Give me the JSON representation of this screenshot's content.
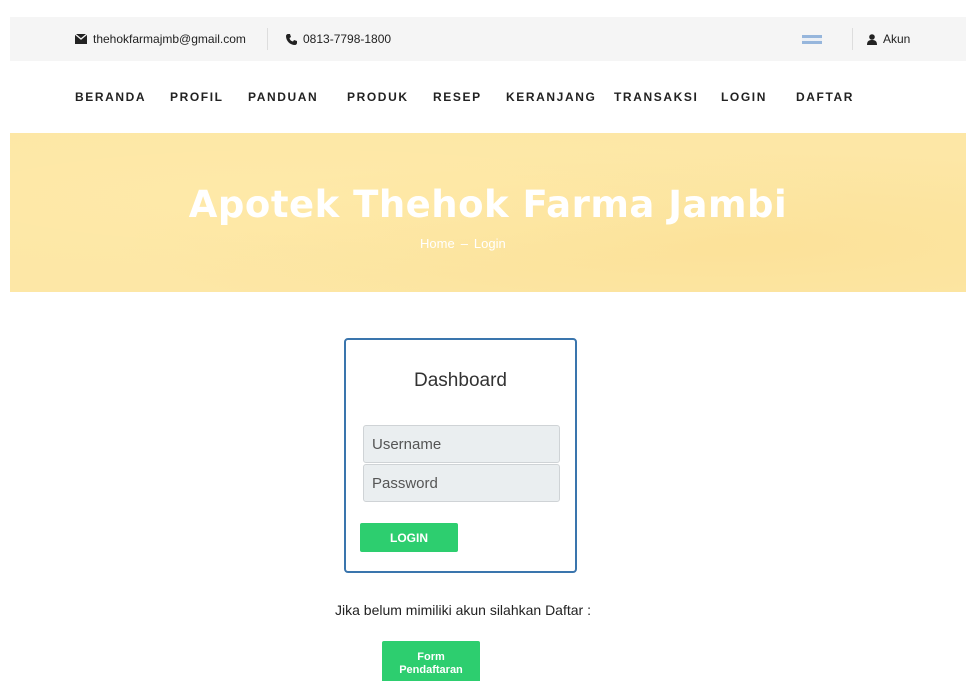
{
  "topbar": {
    "email": "thehokfarmajmb@gmail.com",
    "phone": "0813-7798-1800",
    "account": "Akun"
  },
  "nav": {
    "items": [
      "BERANDA",
      "PROFIL",
      "PANDUAN",
      "PRODUK",
      "RESEP",
      "KERANJANG",
      "TRANSAKSI",
      "LOGIN",
      "DAFTAR"
    ]
  },
  "hero": {
    "title": "Apotek Thehok Farma Jambi",
    "breadcrumb": {
      "home": "Home",
      "separator": "–",
      "current": "Login"
    }
  },
  "login": {
    "title": "Dashboard",
    "username_placeholder": "Username",
    "password_placeholder": "Password",
    "button": "LOGIN"
  },
  "register": {
    "text": "Jika belum mimiliki akun silahkan Daftar :",
    "button_line1": "Form",
    "button_line2": "Pendaftaran"
  },
  "colors": {
    "accent_green": "#2dce6f",
    "panel_border": "#3a75ad",
    "hero_bg": "#fde7a6",
    "topbar_bg": "#f5f5f5"
  }
}
